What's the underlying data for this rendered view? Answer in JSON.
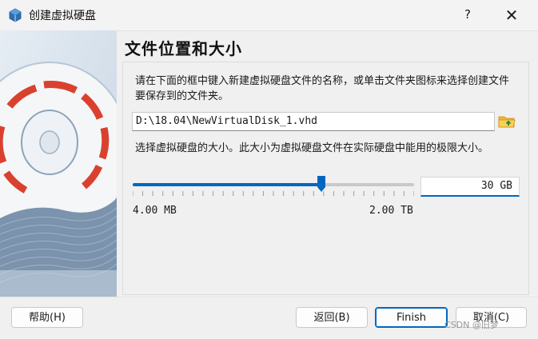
{
  "window": {
    "title": "创建虚拟硬盘",
    "help_glyph": "?",
    "close_glyph": "✕"
  },
  "page": {
    "title": "文件位置和大小",
    "location_description": "请在下面的框中键入新建虚拟硬盘文件的名称，或单击文件夹图标来选择创建文件要保存到的文件夹。",
    "file_path": "D:\\18.04\\NewVirtualDisk_1.vhd",
    "size_description": "选择虚拟硬盘的大小。此大小为虚拟硬盘文件在实际硬盘中能用的极限大小。",
    "size_value": "30 GB",
    "size_min_label": "4.00 MB",
    "size_max_label": "2.00 TB",
    "slider_fraction": 0.67
  },
  "buttons": {
    "help": "帮助(H)",
    "back": "返回(B)",
    "finish": "Finish",
    "cancel": "取消(C)"
  },
  "watermark": "CSDN @旧梦",
  "colors": {
    "accent": "#0067c0",
    "disk_stripe": "#d9412e"
  }
}
